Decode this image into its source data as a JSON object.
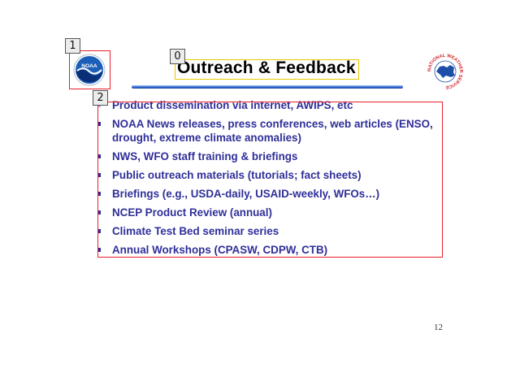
{
  "slide": {
    "title": "Outreach & Feedback",
    "page_number": "12",
    "bullets": [
      "Product dissemination via internet, AWIPS, etc",
      "NOAA News releases, press conferences, web articles (ENSO, drought, extreme climate anomalies)",
      "NWS, WFO staff training & briefings",
      "Public outreach materials (tutorials; fact sheets)",
      "Briefings (e.g., USDA-daily, USAID-weekly, WFOs…)",
      "NCEP Product Review (annual)",
      "Climate Test Bed seminar series",
      "Annual Workshops (CPASW, CDPW, CTB)"
    ]
  },
  "logos": {
    "left": {
      "text": "NOAA",
      "icon": "noaa-logo-icon"
    },
    "right": {
      "text": "NATIONAL WEATHER SERVICE",
      "icon": "nws-logo-icon"
    }
  },
  "annotations": {
    "title_tag": "0",
    "logo_tag": "1",
    "bullets_tag": "2"
  },
  "colors": {
    "bullet_text": "#2f2f9a",
    "title_rule": "#3a6fd8",
    "annotation_red": "#e8202a",
    "annotation_yellow": "#e6c800"
  }
}
